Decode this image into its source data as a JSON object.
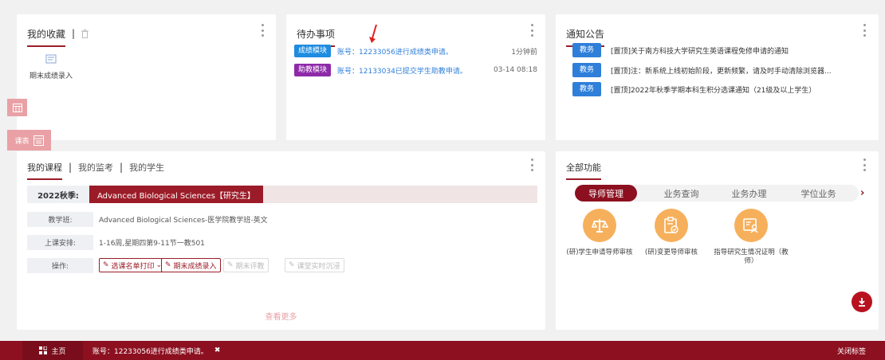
{
  "favorites": {
    "title": "我的收藏",
    "item_label": "期末成绩录入"
  },
  "todo": {
    "title": "待办事项",
    "items": [
      {
        "tag": "成绩模块",
        "text": "账号：12233056进行成绩类申请。",
        "time": "1分钟前",
        "tag_color": "#1e8ce0"
      },
      {
        "tag": "助教模块",
        "text": "账号：12133034已提交学生助教申请。",
        "time": "03-14 08:18",
        "tag_color": "#8e2aa8"
      }
    ]
  },
  "notices": {
    "title": "通知公告",
    "items": [
      {
        "tag": "教务",
        "text": "[置顶]关于南方科技大学研究生英语课程免修申请的通知"
      },
      {
        "tag": "教务",
        "text": "[置顶]注：新系统上线初始阶段，更新频繁，请及时手动清除浏览器..."
      },
      {
        "tag": "教务",
        "text": "[置顶]2022年秋季学期本科生积分选课通知（21级及以上学生）"
      }
    ]
  },
  "courses": {
    "tabs": [
      "我的课程",
      "我的监考",
      "我的学生"
    ],
    "semester": "2022秋季:",
    "course_title": "Advanced Biological Sciences【研究生】",
    "rows": {
      "class_label": "教学班:",
      "class_value": "Advanced Biological Sciences-医学院教学班-英文",
      "schedule_label": "上课安排:",
      "schedule_value": "1-16周,星期四第9-11节一教501",
      "ops_label": "操作:"
    },
    "buttons": {
      "roster": "选课名单打印",
      "grade_entry": "期末成绩录入",
      "eval": "期末评教",
      "realtime": "课堂实时沉浸"
    },
    "more": "查看更多"
  },
  "functions": {
    "title": "全部功能",
    "tabs": [
      "导师管理",
      "业务查询",
      "业务办理",
      "学位业务"
    ],
    "items": [
      {
        "label": "(研)学生申请导师审核",
        "icon": "scale-icon"
      },
      {
        "label": "(研)变更导师审核",
        "icon": "clipboard-check-icon"
      },
      {
        "label": "指导研究生情况证明（教师）",
        "icon": "id-card-icon"
      }
    ]
  },
  "side_tabs": {
    "schedule": "课表"
  },
  "bottom_bar": {
    "home": "主页",
    "active_tab": "账号：12233056进行成绩类申请。",
    "close_tabs": "关闭标签"
  },
  "colors": {
    "brand": "#8c1020",
    "accent_orange": "#f6b05c",
    "link_blue": "#2f7fd9"
  }
}
